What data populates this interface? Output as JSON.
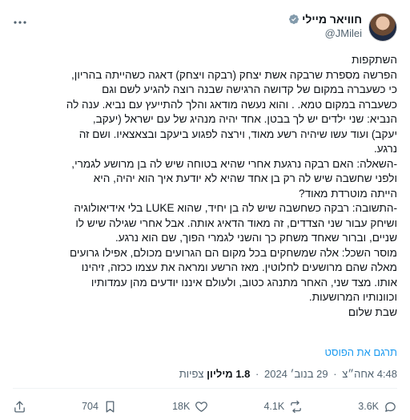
{
  "author": {
    "display_name": "חוויאר מיילי",
    "handle": "@JMilei"
  },
  "post": {
    "lines": [
      "השתקפות",
      "הפרשה מספרת שרבקה אשת יצחק (רבקה ויצחק) דאגה כשהייתה בהריון,",
      "כי כשעברה במקום של קדושה הרגישה שבנה רוצה להגיע לשם וגם",
      "כשעברה במקום טמא. . והוא נעשה מודאג והלך להתייעץ עם נביא. ענה לה",
      "הנביא: שני ילדים יש לך בבטן. אחד יהיה מנהיג של עם ישראל (יעקב,",
      "יעקב) ועוד עשו שיהיה רשע מאוד, וירצה לפגוע ביעקב ובצאצאיו. ושם זה",
      "נרגע.",
      "-השאלה: האם רבקה נרגעת אחרי שהיא בטוחה שיש לה בן מרושע לגמרי,",
      "ולפני שחשבה שיש לה רק בן אחד שהיא לא יודעת איך הוא יהיה, היא",
      "הייתה מוטרדת מאוד?",
      "-התשובה: רבקה כשחשבה שיש לה בן יחיד, שהוא LUKE בלי אידיאולוגיה",
      "ושיחק עבור שני הצדדים, זה מאוד הדאיג אותה. אבל אחרי שגילה שיש לו",
      "שניים, וברור שאחד משחק כך והשני לגמרי הפוך, שם הוא נרגע.",
      "מוסר השכל: אלה שמשחקים בכל מקום הם הגרועים מכולם, אפילו גרועים",
      "מאלה שהם מרושעים לחלוטין. מאז הרשע ומראה את עצמו ככזה, זיהינו",
      "אותו. מצד שני, האחר מתנהג כטוב, ולעולם איננו יודעים מהן עמדותיו",
      "וכוונותיו המרושעות.",
      "שבת שלום"
    ],
    "translate_label": "תרגם את הפוסט"
  },
  "meta": {
    "time": "4:48 אחה״צ",
    "date": "29 בנוב׳ 2024",
    "views_count": "1.8 מיליון",
    "views_label": "צפיות",
    "dot": "·"
  },
  "actions": {
    "replies": "3.6K",
    "reposts": "4.1K",
    "likes": "18K",
    "bookmarks": "704"
  },
  "colors": {
    "accent": "#1d9bf0",
    "muted": "#536471",
    "text": "#0f1419"
  }
}
